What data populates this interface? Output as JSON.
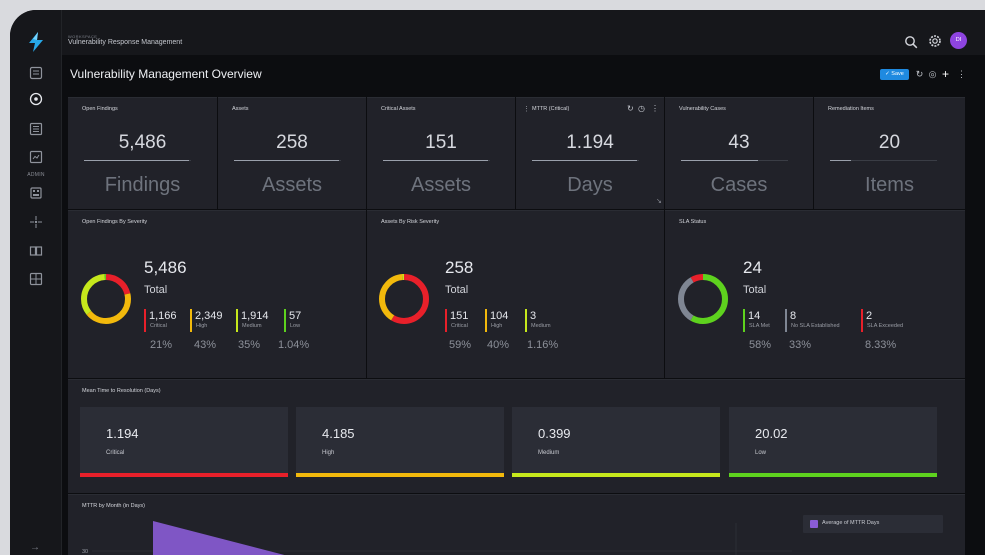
{
  "topbar": {
    "workspace_label": "WORKSPACE",
    "workspace_title": "Vulnerability Response Management",
    "avatar_initials": "DI"
  },
  "sidebar": {
    "admin_label": "ADMIN"
  },
  "page": {
    "title": "Vulnerability Management Overview",
    "save_label": "Save"
  },
  "stats": [
    {
      "label": "Open Findings",
      "value": "5,486",
      "unit": "Findings",
      "progress": 0.98
    },
    {
      "label": "Assets",
      "value": "258",
      "unit": "Assets",
      "progress": 0.98
    },
    {
      "label": "Critical Assets",
      "value": "151",
      "unit": "Assets",
      "progress": 0.98
    },
    {
      "label": "MTTR (Critical)",
      "value": "1.194",
      "unit": "Days",
      "progress": 0.98
    },
    {
      "label": "Vulnerability Cases",
      "value": "43",
      "unit": "Cases",
      "progress": 0.72
    },
    {
      "label": "Remediation Items",
      "value": "20",
      "unit": "Items",
      "progress": 0.2
    }
  ],
  "severity_panel": {
    "title": "Open Findings By Severity",
    "total": "5,486",
    "total_label": "Total",
    "items": [
      {
        "value": "1,166",
        "label": "Critical",
        "pct": "21%",
        "color": "#e8202a"
      },
      {
        "value": "2,349",
        "label": "High",
        "pct": "43%",
        "color": "#f2b90c"
      },
      {
        "value": "1,914",
        "label": "Medium",
        "pct": "35%",
        "color": "#c6e81c"
      },
      {
        "value": "57",
        "label": "Low",
        "pct": "1.04%",
        "color": "#5ed21e"
      }
    ]
  },
  "assets_panel": {
    "title": "Assets By Risk Severity",
    "total": "258",
    "total_label": "Total",
    "items": [
      {
        "value": "151",
        "label": "Critical",
        "pct": "59%",
        "color": "#e8202a"
      },
      {
        "value": "104",
        "label": "High",
        "pct": "40%",
        "color": "#f2b90c"
      },
      {
        "value": "3",
        "label": "Medium",
        "pct": "1.16%",
        "color": "#c6e81c"
      }
    ]
  },
  "sla_panel": {
    "title": "SLA Status",
    "total": "24",
    "total_label": "Total",
    "items": [
      {
        "value": "14",
        "label": "SLA Met",
        "pct": "58%",
        "color": "#5ed21e"
      },
      {
        "value": "8",
        "label": "No SLA Established",
        "pct": "33%",
        "color": "#7f8693"
      },
      {
        "value": "2",
        "label": "SLA Exceeded",
        "pct": "8.33%",
        "color": "#e8202a"
      }
    ]
  },
  "mttr": {
    "title": "Mean Time to Resolution (Days)",
    "cards": [
      {
        "value": "1.194",
        "label": "Critical",
        "color": "#e8202a"
      },
      {
        "value": "4.185",
        "label": "High",
        "color": "#f2b90c"
      },
      {
        "value": "0.399",
        "label": "Medium",
        "color": "#c6e81c"
      },
      {
        "value": "20.02",
        "label": "Low",
        "color": "#5ed21e"
      }
    ]
  },
  "chart_data": {
    "type": "area",
    "title": "MTTR by Month (in Days)",
    "y_ticks": [
      "30"
    ],
    "series": [
      {
        "name": "Average of MTTR Days",
        "color": "#8a5cd6"
      }
    ],
    "legend": "top-right"
  }
}
